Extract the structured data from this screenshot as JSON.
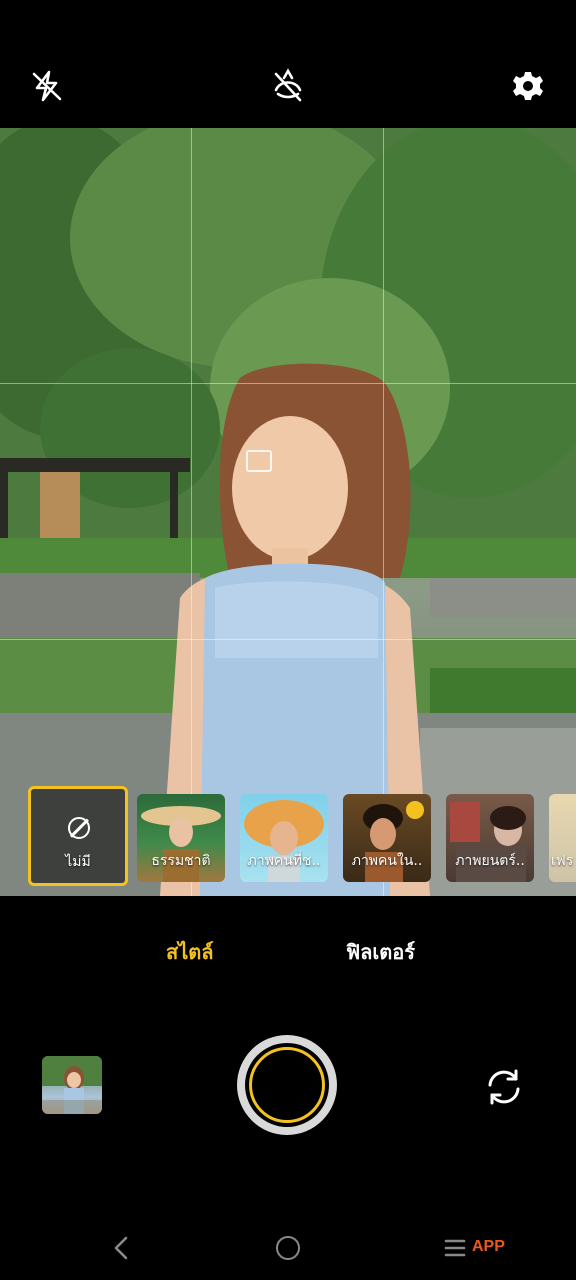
{
  "top_bar": {
    "icons": [
      "flash-off-icon",
      "beauty-off-icon",
      "gear-icon"
    ]
  },
  "filters": [
    {
      "label": "ไม่มี",
      "selected": true,
      "icon": "none-icon"
    },
    {
      "label": "ธรรมชาติ",
      "selected": false
    },
    {
      "label": "ภาพคนที่ช..",
      "selected": false
    },
    {
      "label": "ภาพคนใน..",
      "selected": false
    },
    {
      "label": "ภาพยนตร์..",
      "selected": false
    },
    {
      "label": "เฟร",
      "selected": false
    }
  ],
  "modes": {
    "style": "สไตล์",
    "filter": "ฟิลเตอร์",
    "active": "style"
  },
  "watermark": "APP",
  "colors": {
    "accent": "#f4c21f",
    "background": "#000000"
  }
}
